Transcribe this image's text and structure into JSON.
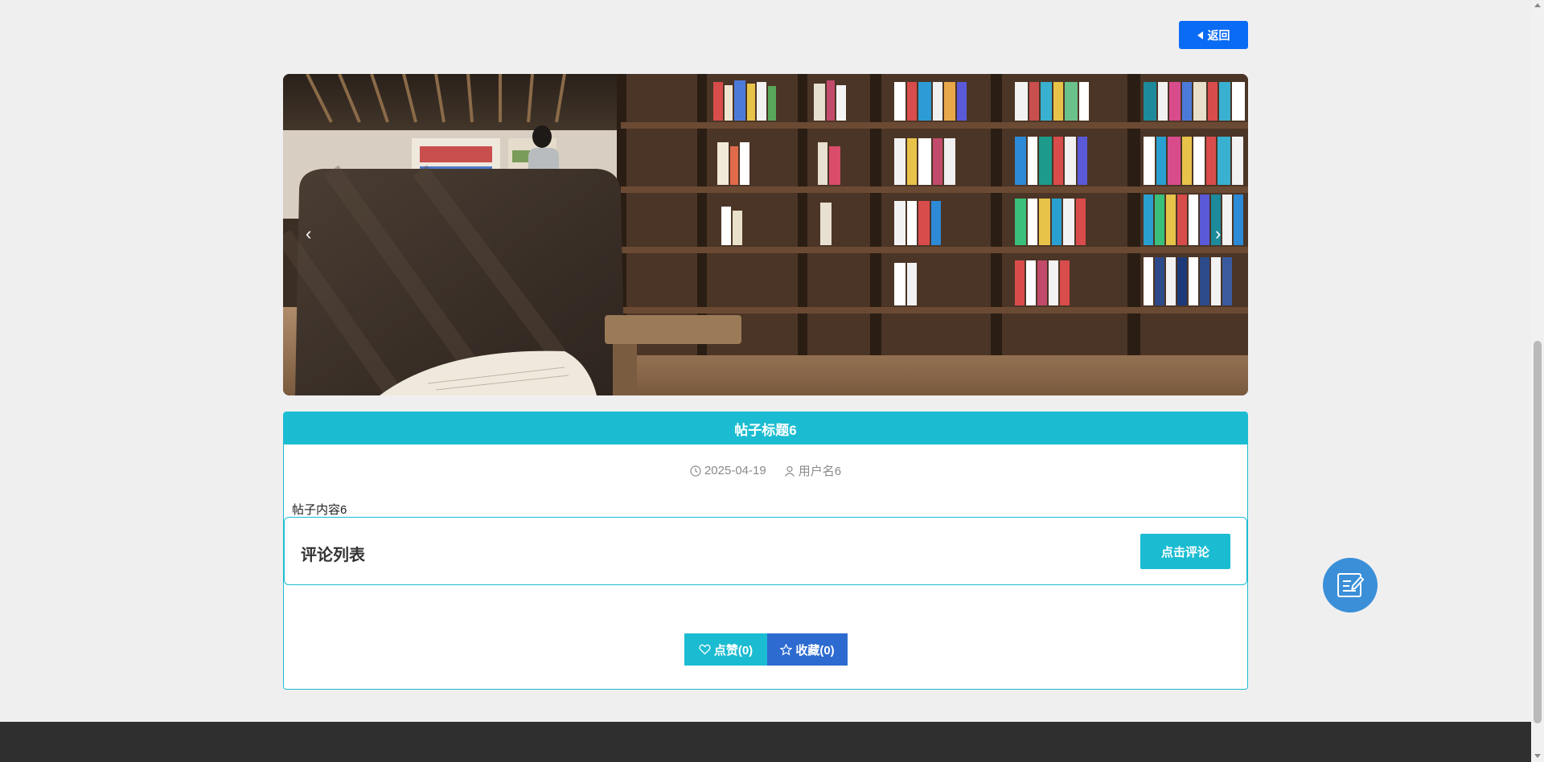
{
  "header": {
    "back_label": "返回"
  },
  "carousel": {
    "prev_symbol": "‹",
    "next_symbol": "›",
    "slide_count": 3,
    "active_slide": 1
  },
  "post": {
    "title": "帖子标题6",
    "date": "2025-04-19",
    "author": "用户名6",
    "content": "帖子内容6"
  },
  "comments": {
    "title": "评论列表",
    "add_label": "点击评论"
  },
  "actions": {
    "like_label": "点赞(0)",
    "favorite_label": "收藏(0)"
  },
  "colors": {
    "accent": "#1bbcd1",
    "primary": "#0a6bf5",
    "favorite": "#2d6bd0",
    "fab": "#3a8fd8",
    "footer": "#2f2f2f"
  },
  "icons": {
    "back": "caret-left-icon",
    "date": "clock-icon",
    "author": "user-icon",
    "like": "heart-icon",
    "favorite": "star-icon",
    "fab": "edit-note-icon"
  }
}
